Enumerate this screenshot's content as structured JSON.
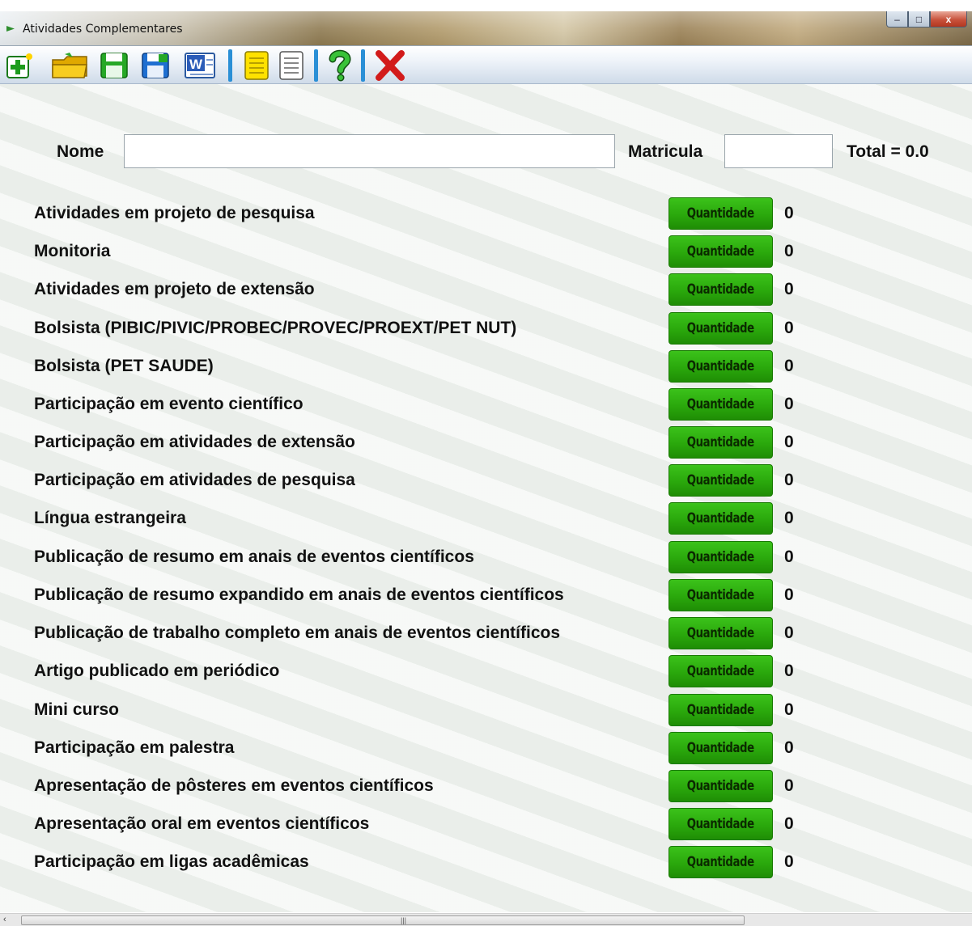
{
  "window": {
    "title": "Atividades Complementares",
    "buttons": {
      "minimize": "–",
      "maximize": "□",
      "close": "x"
    }
  },
  "toolbar": {
    "items": [
      {
        "icon": "new-add-icon"
      },
      {
        "icon": "open-folder-icon"
      },
      {
        "icon": "save-green-icon"
      },
      {
        "icon": "save-blue-icon"
      },
      {
        "icon": "word-export-icon"
      },
      {
        "icon": "note-yellow-icon"
      },
      {
        "icon": "note-white-icon"
      },
      {
        "icon": "help-icon"
      },
      {
        "icon": "close-red-icon"
      }
    ]
  },
  "form": {
    "nome_label": "Nome",
    "nome_value": "",
    "matricula_label": "Matricula",
    "matricula_value": "",
    "total_text": "Total = 0.0"
  },
  "activities": [
    {
      "label": "Atividades em projeto de pesquisa",
      "button": "Quantidade",
      "value": "0"
    },
    {
      "label": "Monitoria",
      "button": "Quantidade",
      "value": "0"
    },
    {
      "label": "Atividades em projeto de extensão",
      "button": "Quantidade",
      "value": "0"
    },
    {
      "label": "Bolsista (PIBIC/PIVIC/PROBEC/PROVEC/PROEXT/PET NUT)",
      "button": "Quantidade",
      "value": "0"
    },
    {
      "label": "Bolsista (PET SAUDE)",
      "button": "Quantidade",
      "value": "0"
    },
    {
      "label": "Participação em evento científico",
      "button": "Quantidade",
      "value": "0"
    },
    {
      "label": "Participação em atividades de extensão",
      "button": "Quantidade",
      "value": "0"
    },
    {
      "label": "Participação em atividades de pesquisa",
      "button": "Quantidade",
      "value": "0"
    },
    {
      "label": "Língua estrangeira",
      "button": "Quantidade",
      "value": "0"
    },
    {
      "label": "Publicação de resumo em anais de eventos científicos",
      "button": "Quantidade",
      "value": "0"
    },
    {
      "label": "Publicação de resumo expandido em anais de eventos científicos",
      "button": "Quantidade",
      "value": "0"
    },
    {
      "label": "Publicação de trabalho completo em anais de eventos científicos",
      "button": "Quantidade",
      "value": "0"
    },
    {
      "label": "Artigo publicado em periódico",
      "button": "Quantidade",
      "value": "0"
    },
    {
      "label": "Mini curso",
      "button": "Quantidade",
      "value": "0"
    },
    {
      "label": "Participação em palestra",
      "button": "Quantidade",
      "value": "0"
    },
    {
      "label": "Apresentação de pôsteres em eventos científicos",
      "button": "Quantidade",
      "value": "0"
    },
    {
      "label": "Apresentação oral em eventos científicos",
      "button": "Quantidade",
      "value": "0"
    },
    {
      "label": "Participação em ligas acadêmicas",
      "button": "Quantidade",
      "value": "0"
    }
  ],
  "colors": {
    "button_green": "#2aa80c",
    "separator_blue": "#2a8fd6",
    "close_red": "#d21b1b"
  }
}
